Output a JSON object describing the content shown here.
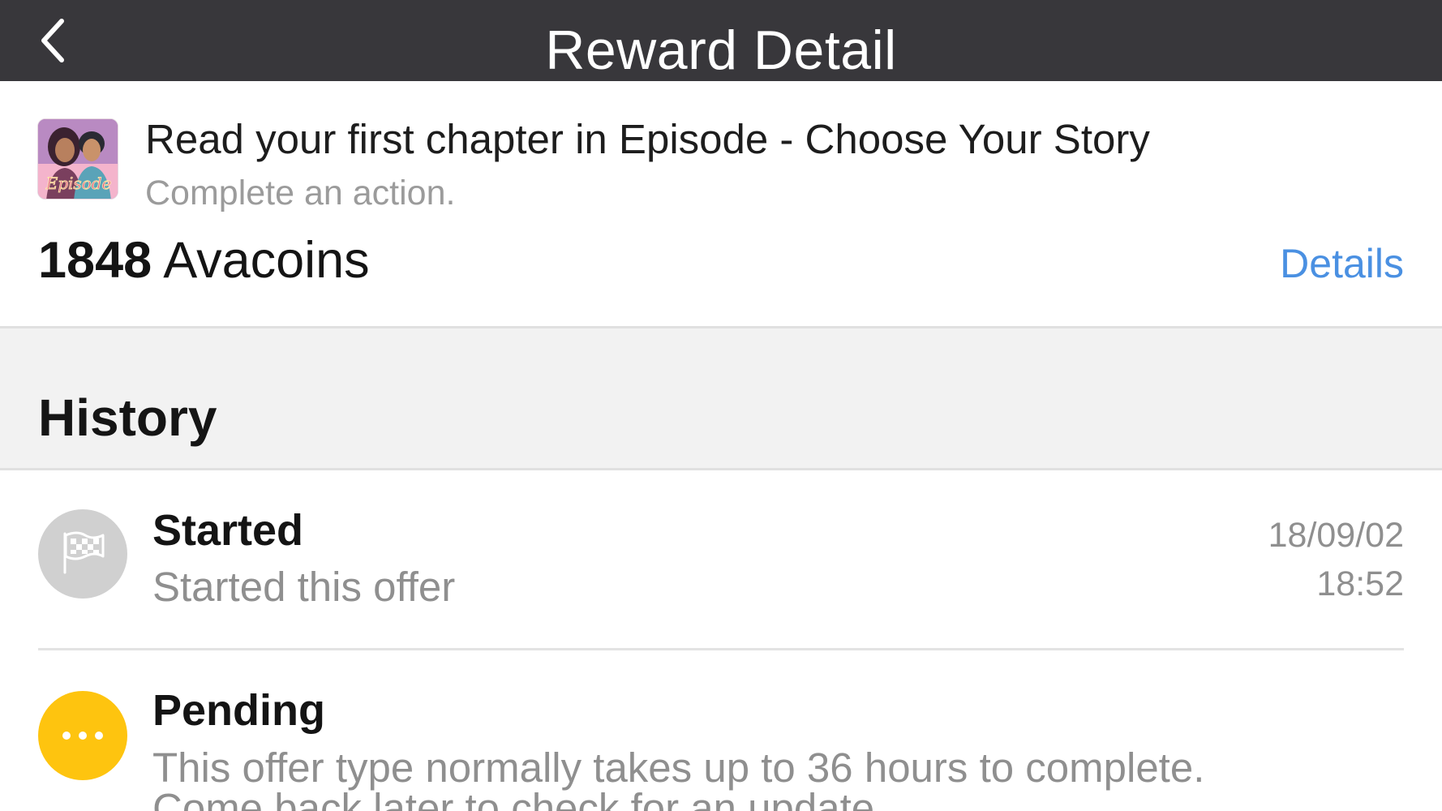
{
  "header": {
    "title": "Reward Detail",
    "back_icon": "chevron-left-icon"
  },
  "offer": {
    "icon": "episode-app-icon",
    "title": "Read your first chapter in Episode - Choose Your Story",
    "subtitle": "Complete an action.",
    "reward_amount": "1848",
    "reward_currency": "Avacoins",
    "details_label": "Details"
  },
  "history": {
    "title": "History",
    "items": [
      {
        "status": "Started",
        "description": "Started this offer",
        "date": "18/09/02",
        "time": "18:52",
        "icon": "flag-icon",
        "color": "#d0d0d0"
      },
      {
        "status": "Pending",
        "description": "This offer type normally takes up to 36 hours to complete.",
        "description_line2": "Come back later to check for an update.",
        "icon": "ellipsis-icon",
        "color": "#fec40f"
      }
    ]
  },
  "colors": {
    "topbar": "#38373b",
    "link": "#4a90e2",
    "pending": "#fec40f"
  }
}
